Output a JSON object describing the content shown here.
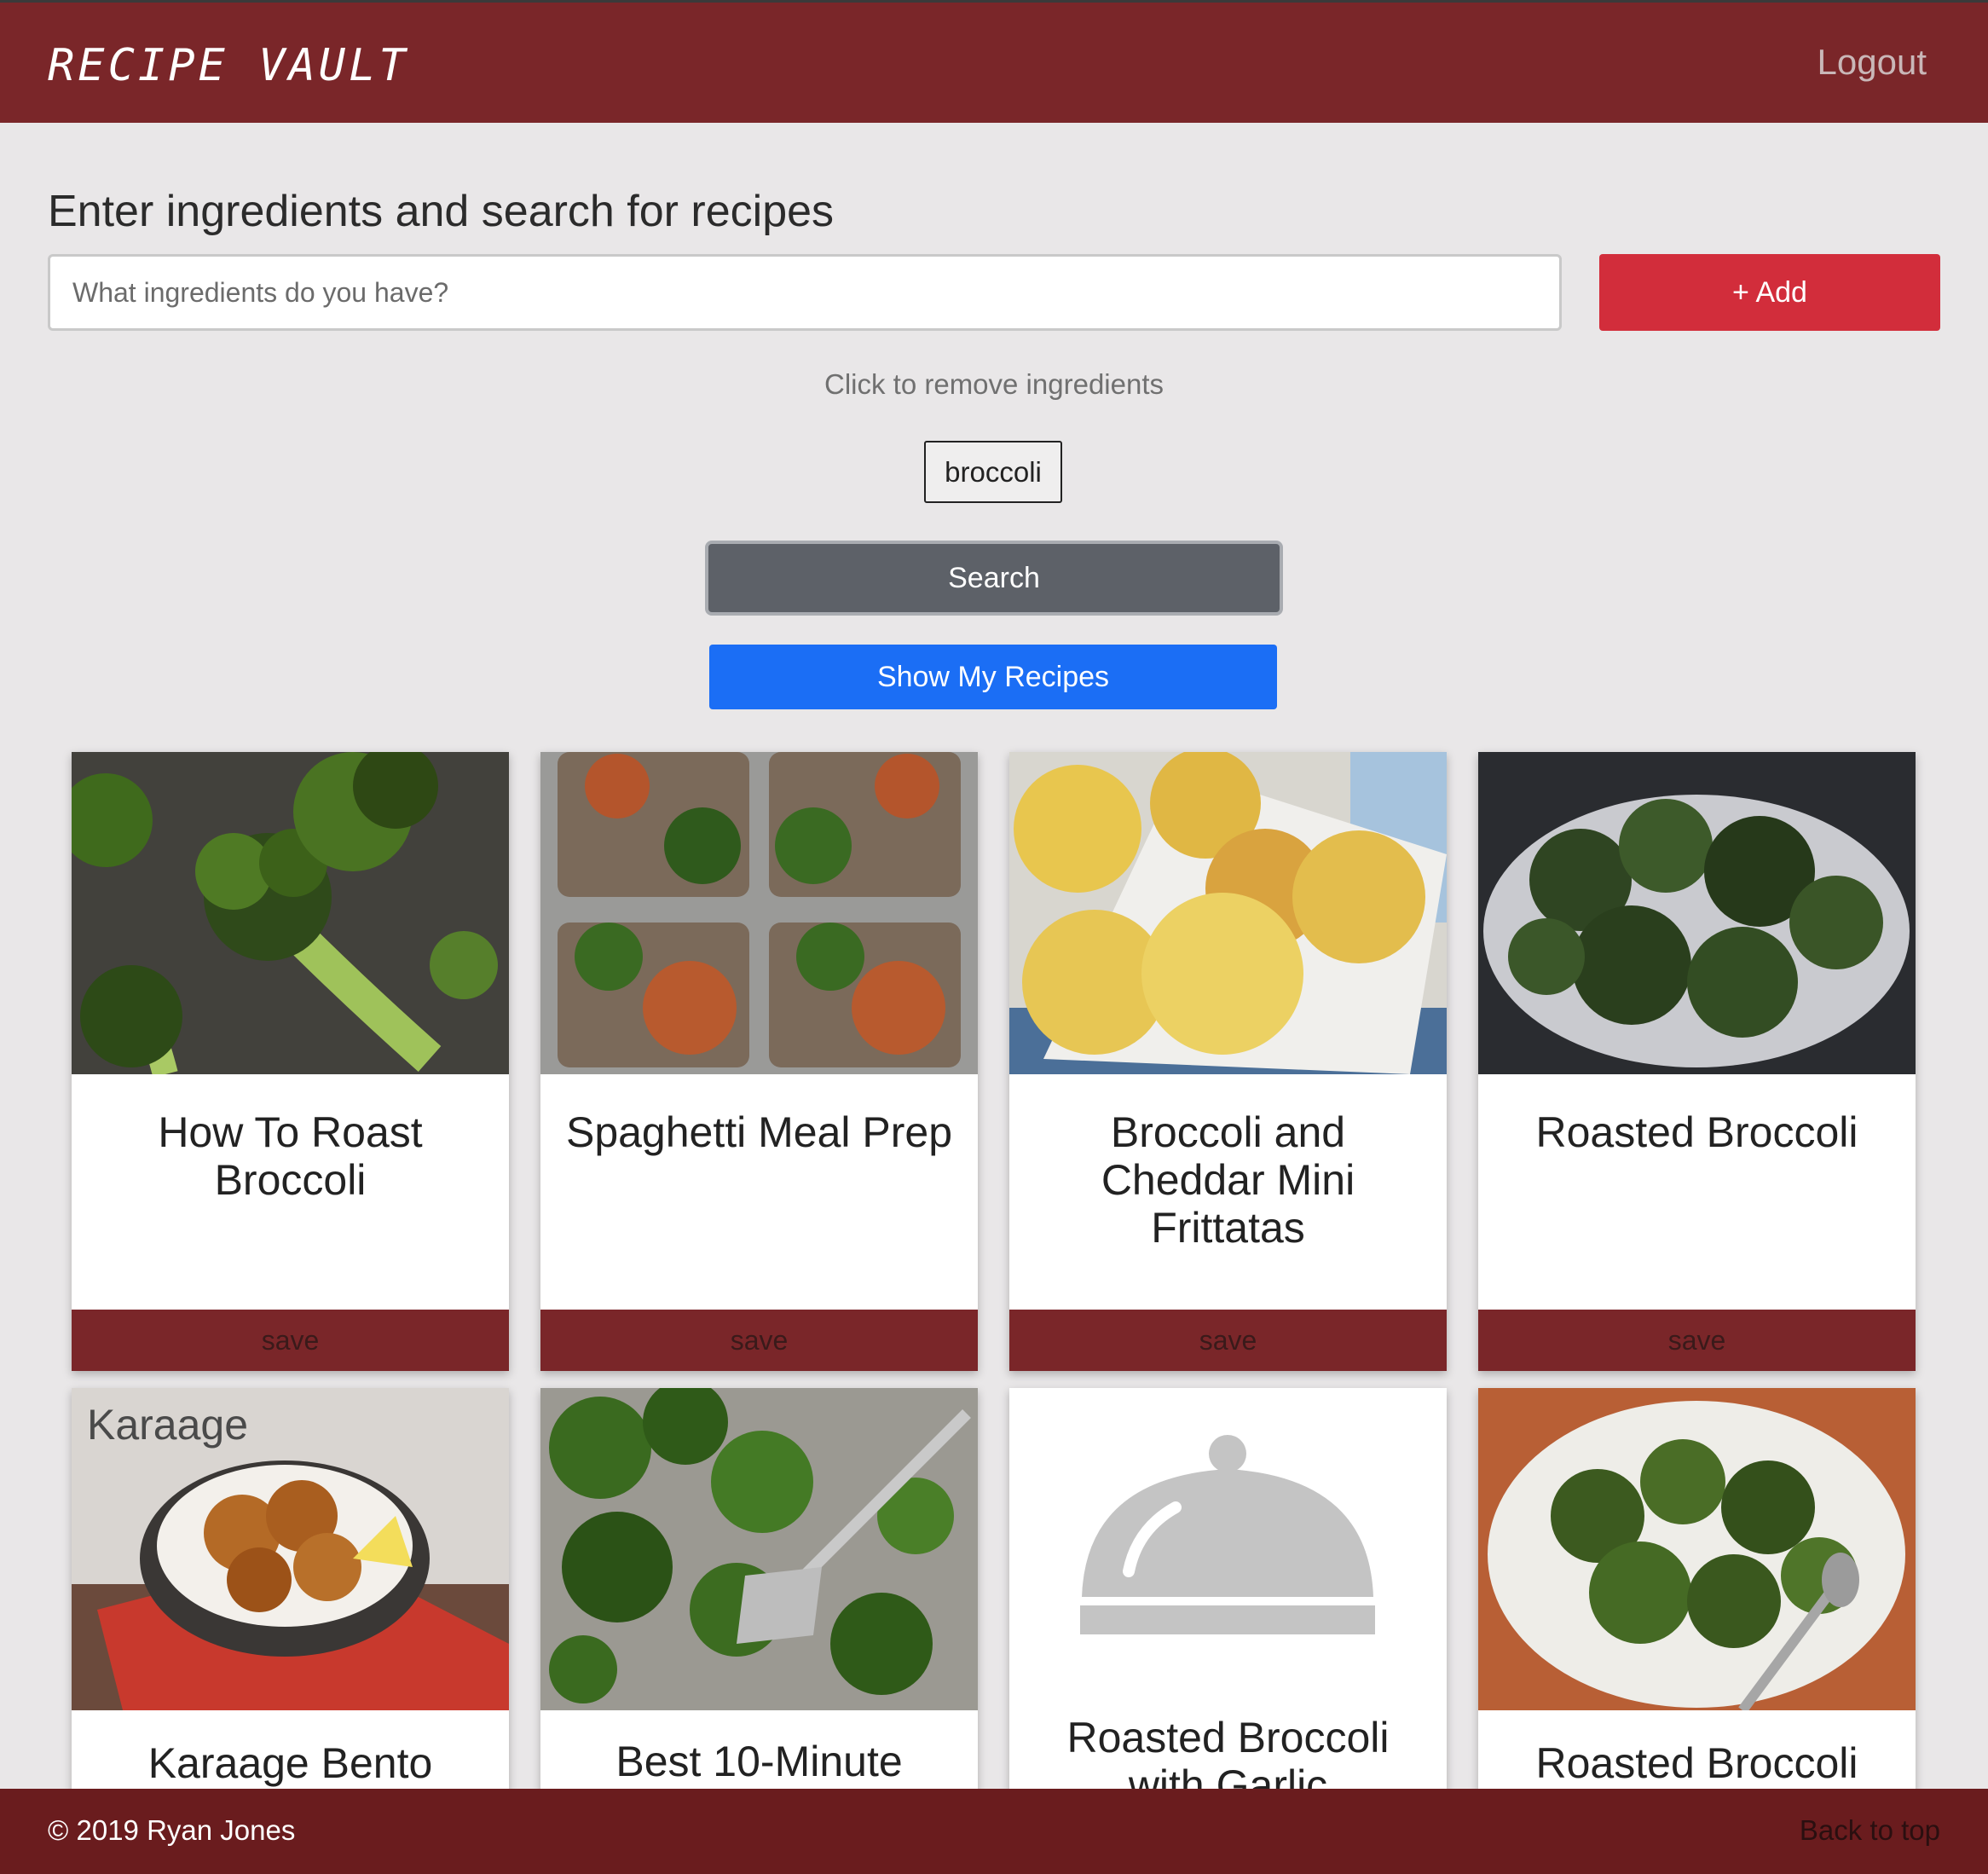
{
  "header": {
    "brand": "Recipe Vault",
    "logout_label": "Logout",
    "background_color": "#7a2629"
  },
  "search": {
    "heading": "Enter ingredients and search for recipes",
    "placeholder": "What ingredients do you have?",
    "value": "",
    "add_label": "+ Add",
    "remove_hint": "Click to remove ingredients",
    "ingredients": [
      "broccoli"
    ],
    "search_label": "Search",
    "show_my_recipes_label": "Show My Recipes"
  },
  "cards": [
    {
      "title": "How To Roast Broccoli",
      "save_label": "save",
      "image": "roasted-broccoli-photo"
    },
    {
      "title": "Spaghetti Meal Prep",
      "save_label": "save",
      "image": "spaghetti-meal-prep-photo"
    },
    {
      "title": "Broccoli and Cheddar Mini Frittatas",
      "save_label": "save",
      "image": "mini-frittatas-photo"
    },
    {
      "title": "Roasted Broccoli",
      "save_label": "save",
      "image": "roasted-broccoli-platter-photo"
    },
    {
      "title": "Karaage Bento",
      "image_caption": "Karaage",
      "image": "karaage-bento-photo"
    },
    {
      "title": "Best 10-Minute",
      "image": "sheet-pan-broccoli-photo"
    },
    {
      "title": "Roasted Broccoli with Garlic",
      "image": "food-cloche-placeholder-icon"
    },
    {
      "title": "Roasted Broccoli",
      "image": "broccoli-plate-photo"
    }
  ],
  "footer": {
    "copyright": "© 2019 Ryan Jones",
    "back_to_top_label": "Back to top"
  },
  "colors": {
    "page_background": "#e9e7e8",
    "accent_red": "#d22d3b",
    "search_gray": "#5d6168",
    "show_blue": "#1b6ef5",
    "card_save_bar": "#7a2629"
  }
}
